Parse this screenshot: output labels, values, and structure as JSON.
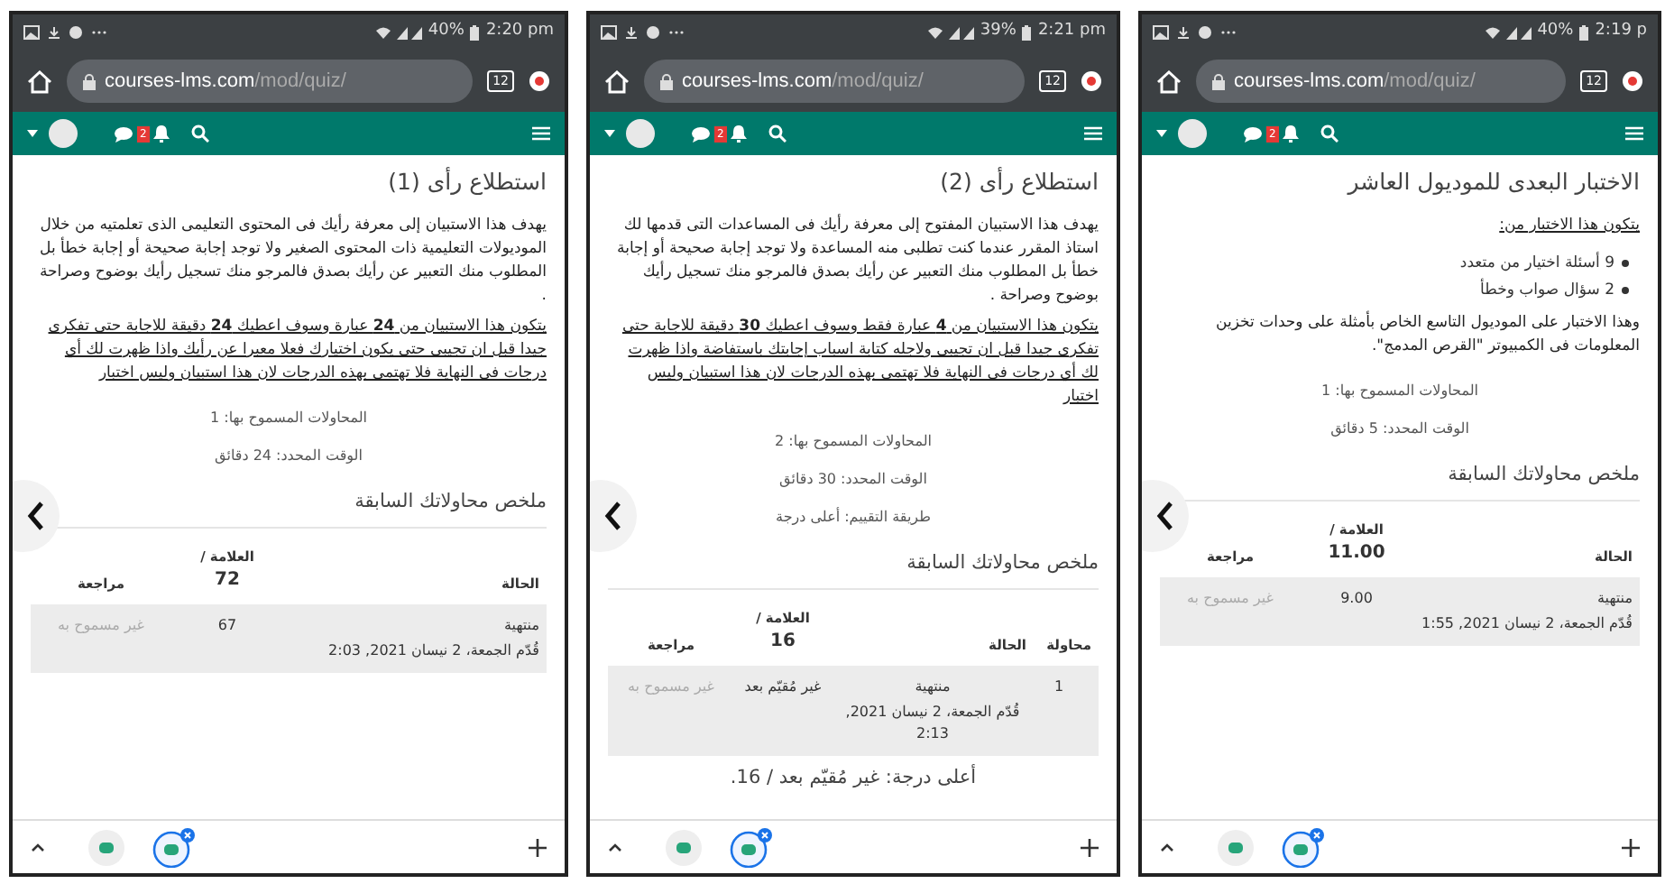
{
  "phones": [
    {
      "status": {
        "battery": "40%",
        "time": "2:19 p"
      },
      "url": {
        "host": "courses-lms.com",
        "path": "/mod/quiz/"
      },
      "tab_count": "12",
      "message_badge": "2",
      "title": "الاختبار البعدى للموديول العاشر",
      "paragraphs": [
        {
          "kind": "underlined",
          "text": "يتكون هذا الاختبار من:"
        },
        {
          "kind": "bullets",
          "items": [
            "9 أسئلة اختيار من متعدد",
            "2 سؤال صواب وخطأ"
          ]
        },
        {
          "kind": "plain",
          "text": "وهذا الاختبار على الموديول التاسع الخاص بأمثلة على وحدات تخزين المعلومات فى الكمبيوتر \"القرص المدمج\"."
        }
      ],
      "info": [
        "المحاولات المسموح بها: 1",
        "الوقت المحدد: 5 دقائق"
      ],
      "summary_heading": "ملخص محاولاتك السابقة",
      "table": {
        "columns": [
          {
            "label": "الحالة"
          },
          {
            "label": "العلامة /",
            "max": "11.00"
          },
          {
            "label": "مراجعة"
          }
        ],
        "rows": [
          [
            {
              "lines": [
                "منتهية",
                "قُدّم الجمعة، 2 نيسان 2021, 1:55"
              ],
              "dimmed": false
            },
            {
              "lines": [
                "9.00"
              ],
              "dimmed": false
            },
            {
              "lines": [
                "غير مسموح به"
              ],
              "dimmed": true
            }
          ]
        ]
      }
    },
    {
      "status": {
        "battery": "39%",
        "time": "2:21 pm"
      },
      "url": {
        "host": "courses-lms.com",
        "path": "/mod/quiz/"
      },
      "tab_count": "12",
      "message_badge": "2",
      "title": "استطلاع رأى (2)",
      "paragraphs": [
        {
          "kind": "plain",
          "text": "يهدف هذا الاستبيان المفتوح إلى معرفة رأيك فى المساعدات التى قدمها لك استاذ المقرر عندما كنت تطلبى منه المساعدة ولا توجد إجابة صحيحة أو إجابة خطأ بل المطلوب منك التعبير عن رأيك بصدق فالمرجو منك تسجيل رأيك بوضوح وصراحة ."
        },
        {
          "kind": "underlined",
          "text": "يتكون هذا الاستبيان من **4** عبارة فقط وسوف اعطيك **30** دقيقة للاجابة حتى تفكرى جيدا قبل ان تجيبى ولاجله كتابة اسباب إجابتك باستفاضة واذا ظهرت لك أي درجات فى النهاية فلا تهتمى بهذه الدرجات لان هذا استبيان وليس اختبار"
        }
      ],
      "info": [
        "المحاولات المسموح بها: 2",
        "الوقت المحدد: 30 دقائق",
        "طريقة التقييم: أعلى درجة"
      ],
      "summary_heading": "ملخص محاولاتك السابقة",
      "table": {
        "columns": [
          {
            "label": "محاولة"
          },
          {
            "label": "الحالة"
          },
          {
            "label": "العلامة /",
            "max": "16"
          },
          {
            "label": "مراجعة"
          }
        ],
        "rows": [
          [
            {
              "lines": [
                "1"
              ],
              "dimmed": false
            },
            {
              "lines": [
                "منتهية",
                "قُدّم الجمعة، 2 نيسان 2021, 2:13"
              ],
              "dimmed": false
            },
            {
              "lines": [
                "غير مُقيّم بعد"
              ],
              "dimmed": false
            },
            {
              "lines": [
                "غير مسموح به"
              ],
              "dimmed": true
            }
          ]
        ]
      },
      "footer": "أعلى درجة: غير مُقيّم بعد / 16."
    },
    {
      "status": {
        "battery": "40%",
        "time": "2:20 pm"
      },
      "url": {
        "host": "courses-lms.com",
        "path": "/mod/quiz/"
      },
      "tab_count": "12",
      "message_badge": "2",
      "title": "استطلاع رأى (1)",
      "paragraphs": [
        {
          "kind": "plain",
          "text": "يهدف هذا الاستبيان إلى معرفة رأيك فى المحتوى التعليمى الذى تعلمتيه من خلال الموديولات التعليمية ذات المحتوى الصغير ولا توجد إجابة صحيحة أو إجابة خطأ بل المطلوب منك التعبير عن رأيك بصدق فالمرجو منك تسجيل رأيك بوضوح وصراحة ."
        },
        {
          "kind": "underlined",
          "text": "يتكون هذا الاستبيان من **24** عبارة وسوف اعطيك **24** دقيقة للاجابة حتى تفكرى جيدا قبل ان تجيبى حتى يكون اختيارك فعلا معبرا عن رأيك واذا ظهرت لك أي درجات فى النهاية فلا تهتمى بهذه الدرجات لان هذا استبيان وليس اختبار"
        }
      ],
      "info": [
        "المحاولات المسموح بها: 1",
        "الوقت المحدد: 24 دقائق"
      ],
      "summary_heading": "ملخص محاولاتك السابقة",
      "table": {
        "columns": [
          {
            "label": "الحالة"
          },
          {
            "label": "العلامة /",
            "max": "72"
          },
          {
            "label": "مراجعة"
          }
        ],
        "rows": [
          [
            {
              "lines": [
                "منتهية",
                "قُدّم الجمعة، 2 نيسان 2021, 2:03"
              ],
              "dimmed": false
            },
            {
              "lines": [
                "67"
              ],
              "dimmed": false
            },
            {
              "lines": [
                "غير مسموح به"
              ],
              "dimmed": true
            }
          ]
        ]
      }
    }
  ]
}
